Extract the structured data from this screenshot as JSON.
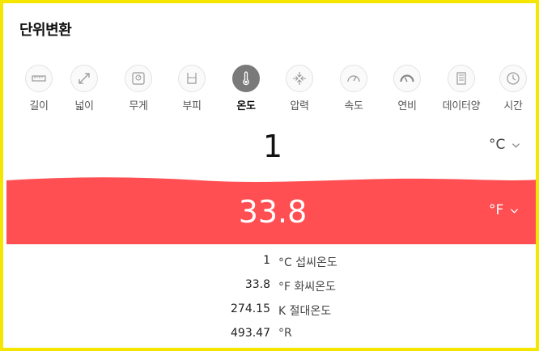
{
  "title": "단위변환",
  "categories": [
    {
      "label": "길이",
      "icon": "ruler-icon"
    },
    {
      "label": "넓이",
      "icon": "expand-arrows-icon"
    },
    {
      "label": "무게",
      "icon": "scale-icon"
    },
    {
      "label": "부피",
      "icon": "beaker-icon"
    },
    {
      "label": "온도",
      "icon": "thermometer-icon",
      "active": true
    },
    {
      "label": "압력",
      "icon": "compress-arrows-icon"
    },
    {
      "label": "속도",
      "icon": "speedometer-icon"
    },
    {
      "label": "연비",
      "icon": "fuel-gauge-icon"
    },
    {
      "label": "데이터양",
      "icon": "document-icon"
    },
    {
      "label": "시간",
      "icon": "clock-icon"
    }
  ],
  "input": {
    "value": "1",
    "unit": "°C"
  },
  "output": {
    "value": "33.8",
    "unit": "°F"
  },
  "results": [
    {
      "value": "1",
      "unit": "°C 섭씨온도"
    },
    {
      "value": "33.8",
      "unit": "°F 화씨온도"
    },
    {
      "value": "274.15",
      "unit": "K 절대온도"
    },
    {
      "value": "493.47",
      "unit": "°R"
    }
  ],
  "colors": {
    "accent": "#ff4f52",
    "frame": "#f5e600",
    "active_icon": "#7a7a7a"
  }
}
